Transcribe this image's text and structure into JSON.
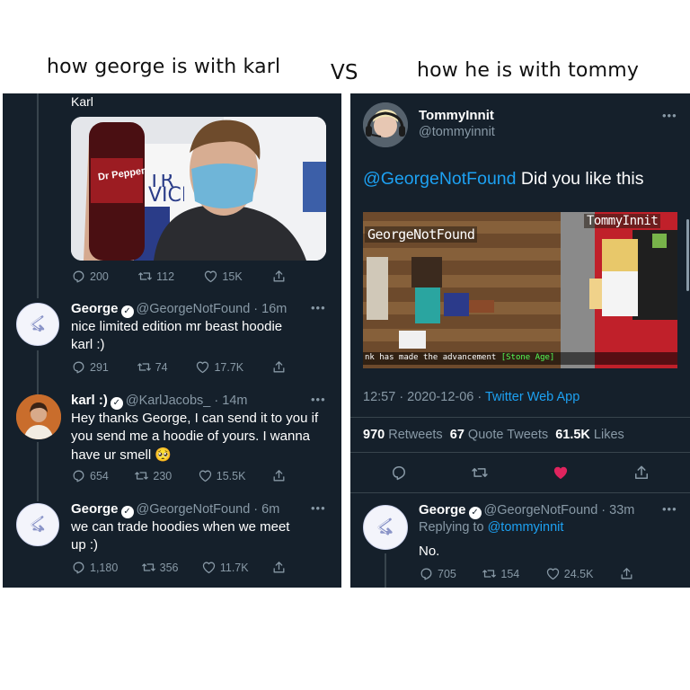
{
  "captions": {
    "left": "how george is with karl",
    "vs": "VS",
    "right": "how he is with tommy"
  },
  "left_panel": {
    "top_tweet": {
      "author_name": "Karl",
      "image_bottle_label": "Dr Pepper",
      "image_sign_text": "TR VICE",
      "replies": "200",
      "retweets": "112",
      "likes": "15K"
    },
    "tweets": [
      {
        "name": "George",
        "handle": "@GeorgeNotFound",
        "time": "16m",
        "text_lines": [
          "nice limited edition mr beast hoodie",
          "karl :)"
        ],
        "replies": "291",
        "retweets": "74",
        "likes": "17.7K"
      },
      {
        "name": "karl :)",
        "handle": "@KarlJacobs_",
        "time": "14m",
        "text_lines": [
          "Hey thanks George, I can send it to you if",
          "you send me a hoodie of yours. I wanna",
          "have ur smell"
        ],
        "emoji": "🥺",
        "replies": "654",
        "retweets": "230",
        "likes": "15.5K"
      },
      {
        "name": "George",
        "handle": "@GeorgeNotFound",
        "time": "6m",
        "text_lines": [
          "we can trade hoodies when we meet",
          "up :)"
        ],
        "replies": "1,180",
        "retweets": "356",
        "likes": "11.7K"
      }
    ]
  },
  "right_panel": {
    "main_tweet": {
      "name": "TommyInnit",
      "handle": "@tommyinnit",
      "mention": "@GeorgeNotFound",
      "text": " Did you like this",
      "image_nametag_left": "GeorgeNotFound",
      "image_nametag_right": "TommyInnit",
      "image_chat_prefix": "nk has made the advancement ",
      "image_chat_highlight": "[Stone Age]",
      "timestamp": "12:57 · 2020-12-06 · ",
      "app": "Twitter Web App",
      "retweets_count": "970",
      "retweets_label": "Retweets",
      "quotes_count": "67",
      "quotes_label": "Quote Tweets",
      "likes_count": "61.5K",
      "likes_label": "Likes"
    },
    "reply": {
      "name": "George",
      "handle": "@GeorgeNotFound",
      "time": "33m",
      "replying_prefix": "Replying to ",
      "replying_to": "@tommyinnit",
      "text": "No.",
      "replies": "705",
      "retweets": "154",
      "likes": "24.5K"
    }
  },
  "colors": {
    "background": "#15202b",
    "link": "#1da1f2",
    "muted": "#8899a6",
    "like_active": "#e0245e"
  },
  "icons": [
    "reply-icon",
    "retweet-icon",
    "like-icon",
    "share-icon",
    "verified-icon",
    "more-icon"
  ]
}
